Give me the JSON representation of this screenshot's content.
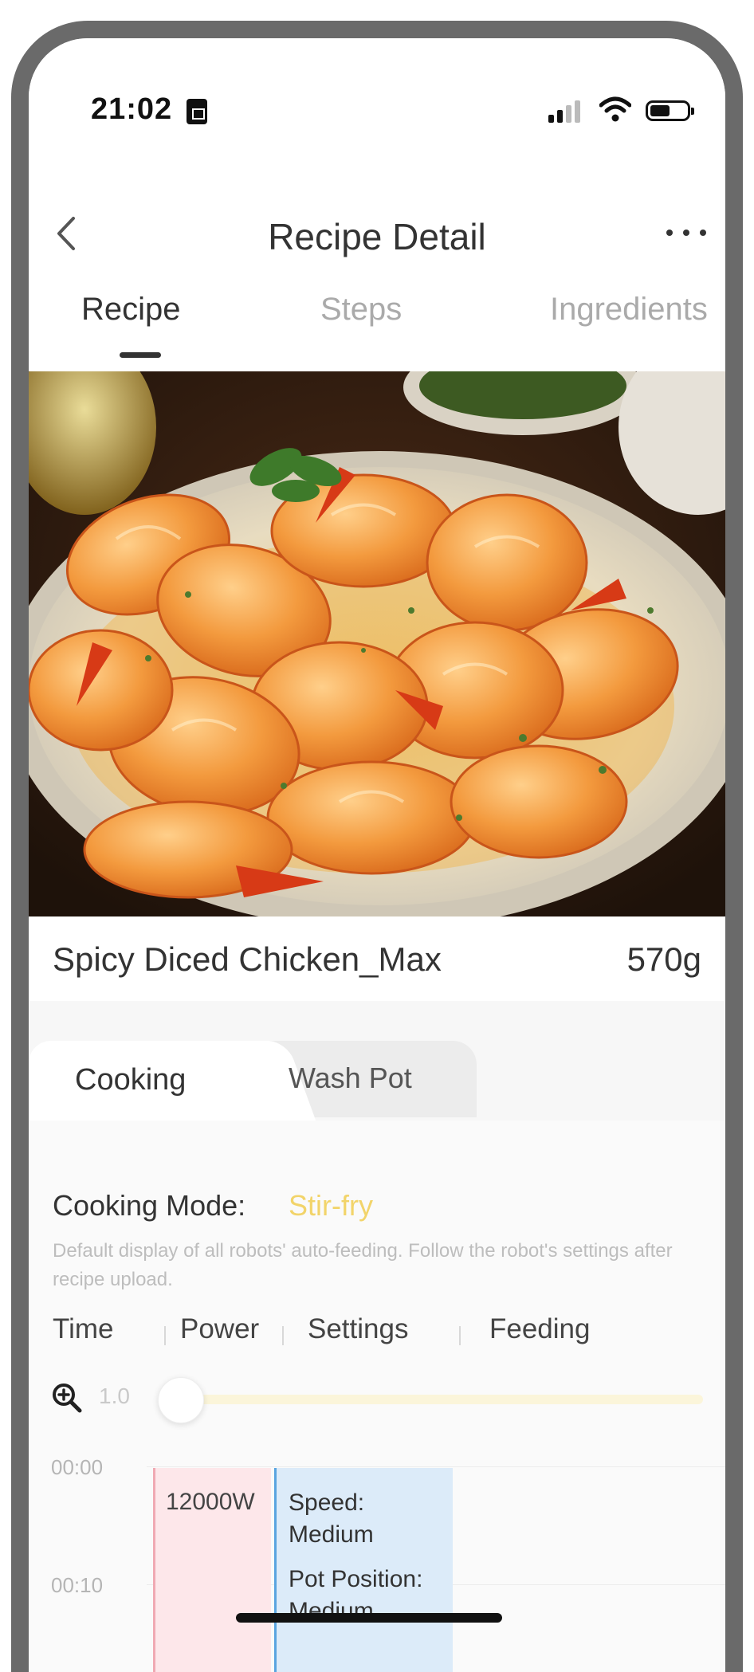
{
  "status_bar": {
    "time": "21:02"
  },
  "header": {
    "title": "Recipe Detail"
  },
  "tabs": [
    {
      "label": "Recipe",
      "active": true
    },
    {
      "label": "Steps",
      "active": false
    },
    {
      "label": "Ingredients",
      "active": false
    }
  ],
  "recipe": {
    "name": "Spicy Diced Chicken_Max",
    "weight": "570g"
  },
  "sub_tabs": {
    "cooking": "Cooking",
    "wash_pot": "Wash Pot"
  },
  "cooking_mode": {
    "label": "Cooking Mode:",
    "value": "Stir-fry",
    "value_color": "#f2d46a",
    "description": "Default display of all robots' auto-feeding. Follow the robot's settings after recipe upload."
  },
  "columns": [
    "Time",
    "Power",
    "Settings",
    "Feeding"
  ],
  "zoom": {
    "value": "1.0",
    "level": 0.0
  },
  "timeline": {
    "times": [
      "00:00",
      "00:10"
    ],
    "power": "12000W",
    "settings": {
      "speed_label": "Speed:",
      "speed_value": "Medium",
      "pot_label": "Pot Position:",
      "pot_value": "Medium"
    }
  },
  "colors": {
    "power_block": "#fde7ea",
    "settings_block": "#dcebf9",
    "accent": "#f2d46a"
  }
}
